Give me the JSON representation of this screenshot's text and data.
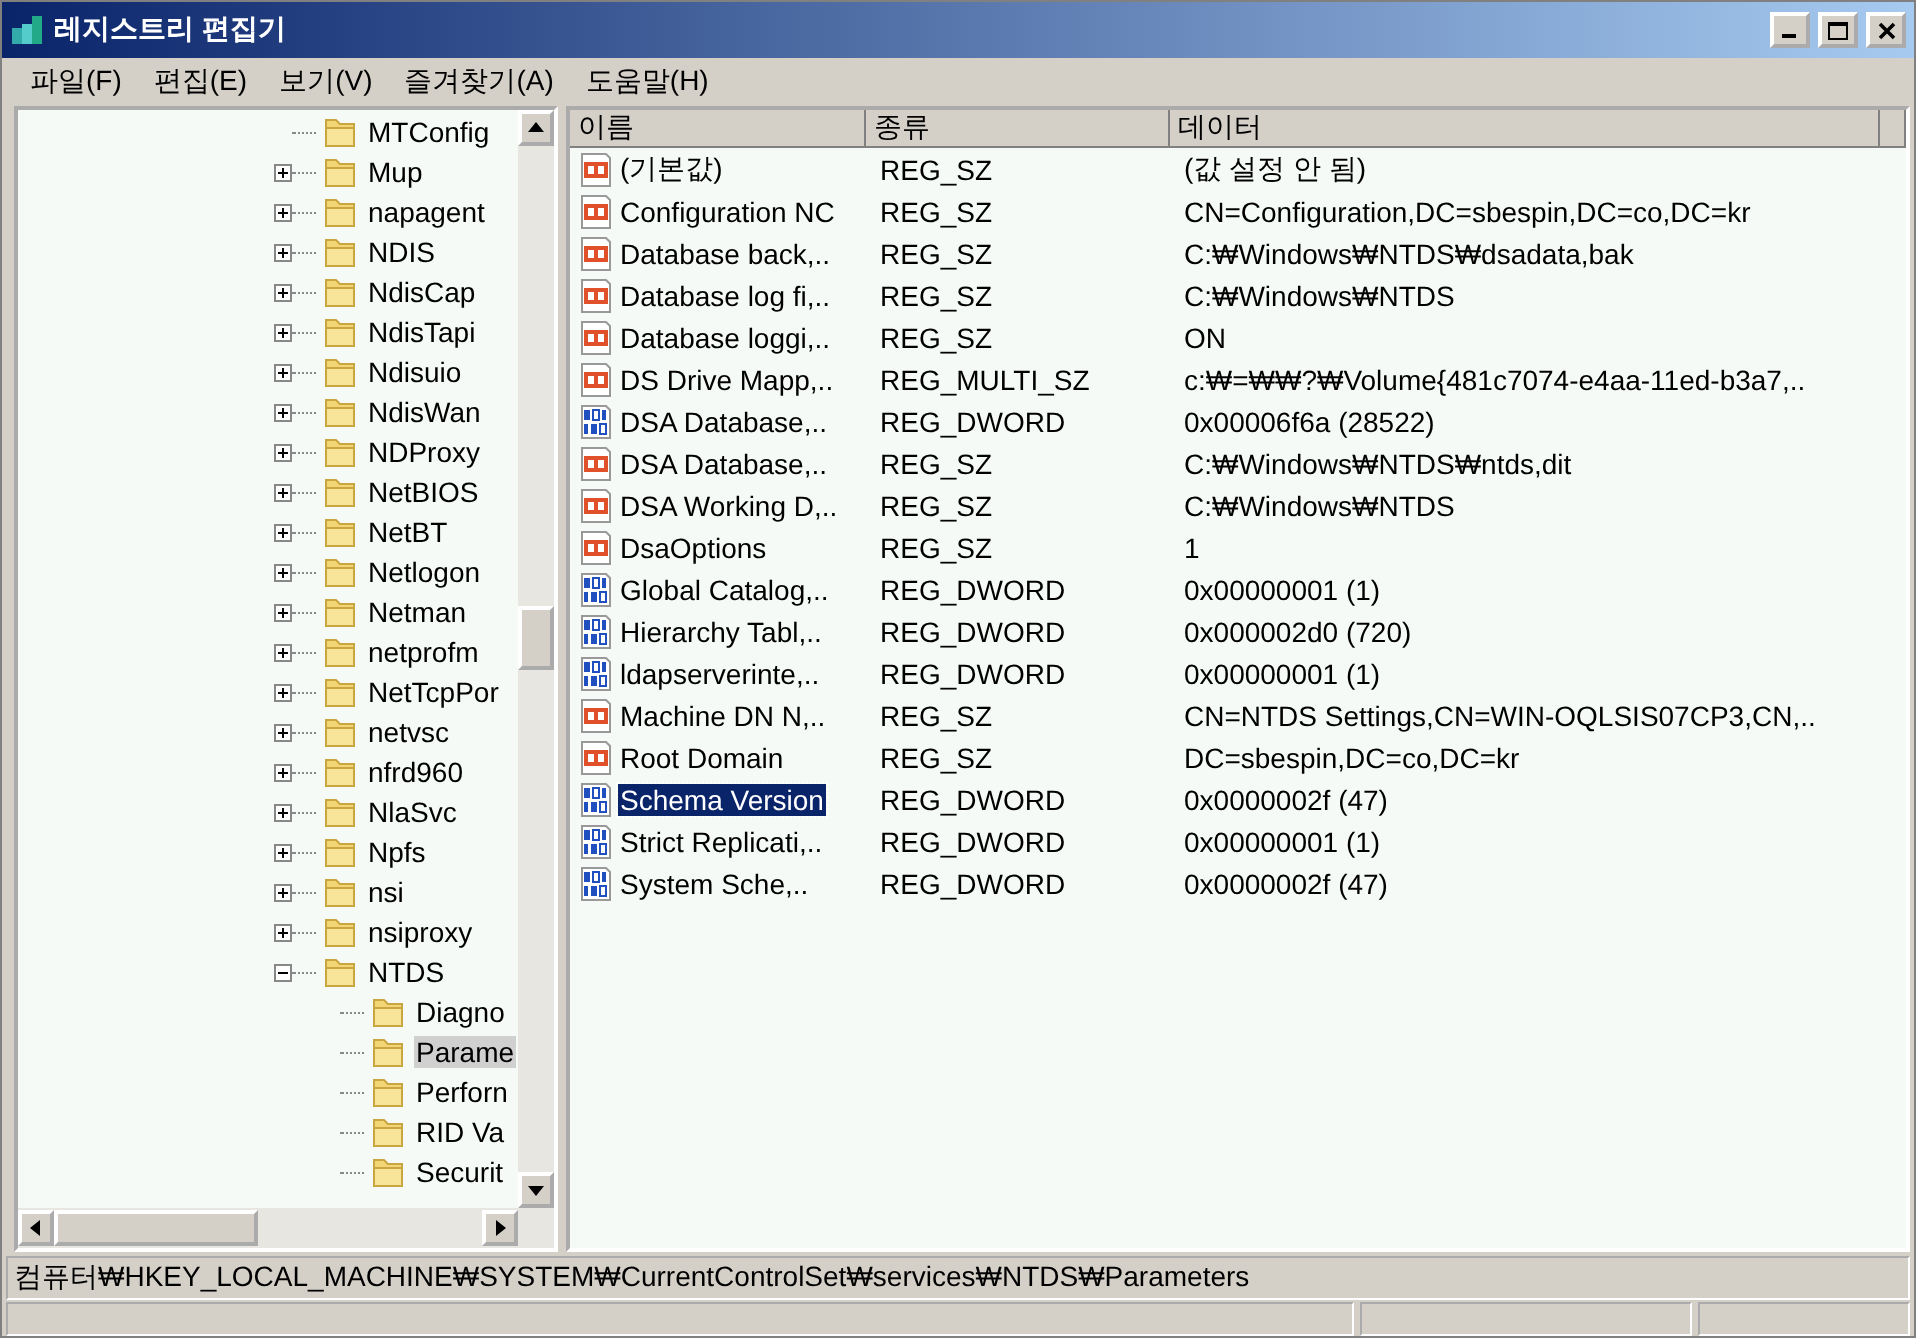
{
  "window": {
    "title": "레지스트리 편집기"
  },
  "menu": [
    "파일(F)",
    "편집(E)",
    "보기(V)",
    "즐겨찾기(A)",
    "도움말(H)"
  ],
  "tree": [
    {
      "label": "MTConfig",
      "selected": false
    },
    {
      "label": "Mup",
      "expanded": false,
      "selected": false
    },
    {
      "label": "napagent",
      "expanded": false,
      "selected": false
    },
    {
      "label": "NDIS",
      "expanded": false,
      "selected": false
    },
    {
      "label": "NdisCap",
      "expanded": false,
      "selected": false
    },
    {
      "label": "NdisTapi",
      "expanded": false,
      "selected": false
    },
    {
      "label": "Ndisuio",
      "expanded": false,
      "selected": false
    },
    {
      "label": "NdisWan",
      "expanded": false,
      "selected": false
    },
    {
      "label": "NDProxy",
      "expanded": false,
      "selected": false
    },
    {
      "label": "NetBIOS",
      "expanded": false,
      "selected": false
    },
    {
      "label": "NetBT",
      "expanded": false,
      "selected": false
    },
    {
      "label": "Netlogon",
      "expanded": false,
      "selected": false
    },
    {
      "label": "Netman",
      "expanded": false,
      "selected": false
    },
    {
      "label": "netprofm",
      "expanded": false,
      "selected": false
    },
    {
      "label": "NetTcpPor",
      "expanded": false,
      "selected": false
    },
    {
      "label": "netvsc",
      "expanded": false,
      "selected": false
    },
    {
      "label": "nfrd960",
      "expanded": false,
      "selected": false
    },
    {
      "label": "NlaSvc",
      "expanded": false,
      "selected": false
    },
    {
      "label": "Npfs",
      "expanded": false,
      "selected": false
    },
    {
      "label": "nsi",
      "expanded": false,
      "selected": false
    },
    {
      "label": "nsiproxy",
      "expanded": false,
      "selected": false
    },
    {
      "label": "NTDS",
      "expanded": true,
      "selected": false,
      "children": [
        {
          "label": "Diagno",
          "selected": false
        },
        {
          "label": "Parame",
          "selected": true
        },
        {
          "label": "Perforn",
          "selected": false
        },
        {
          "label": "RID Va",
          "selected": false
        },
        {
          "label": "Securit",
          "selected": false
        }
      ]
    }
  ],
  "table": {
    "columns": [
      "이름",
      "종류",
      "데이터"
    ],
    "rows": [
      {
        "kind": "string",
        "name": "(기본값)",
        "type": "REG_SZ",
        "data": "(값 설정 안 됨)",
        "selected": false
      },
      {
        "kind": "string",
        "name": "Configuration NC",
        "type": "REG_SZ",
        "data": "CN=Configuration,DC=sbespin,DC=co,DC=kr",
        "selected": false
      },
      {
        "kind": "string",
        "name": "Database back,..",
        "type": "REG_SZ",
        "data": "C:₩Windows₩NTDS₩dsadata,bak",
        "selected": false
      },
      {
        "kind": "string",
        "name": "Database log fi,..",
        "type": "REG_SZ",
        "data": "C:₩Windows₩NTDS",
        "selected": false
      },
      {
        "kind": "string",
        "name": "Database loggi,..",
        "type": "REG_SZ",
        "data": "ON",
        "selected": false
      },
      {
        "kind": "string",
        "name": "DS Drive Mapp,..",
        "type": "REG_MULTI_SZ",
        "data": "c:₩=₩₩?₩Volume{481c7074-e4aa-11ed-b3a7,..",
        "selected": false
      },
      {
        "kind": "dword",
        "name": "DSA Database,..",
        "type": "REG_DWORD",
        "data": "0x00006f6a (28522)",
        "selected": false
      },
      {
        "kind": "string",
        "name": "DSA Database,..",
        "type": "REG_SZ",
        "data": "C:₩Windows₩NTDS₩ntds,dit",
        "selected": false
      },
      {
        "kind": "string",
        "name": "DSA Working D,..",
        "type": "REG_SZ",
        "data": "C:₩Windows₩NTDS",
        "selected": false
      },
      {
        "kind": "string",
        "name": "DsaOptions",
        "type": "REG_SZ",
        "data": "1",
        "selected": false
      },
      {
        "kind": "dword",
        "name": "Global Catalog,..",
        "type": "REG_DWORD",
        "data": "0x00000001 (1)",
        "selected": false
      },
      {
        "kind": "dword",
        "name": "Hierarchy Tabl,..",
        "type": "REG_DWORD",
        "data": "0x000002d0 (720)",
        "selected": false
      },
      {
        "kind": "dword",
        "name": "ldapserverinte,..",
        "type": "REG_DWORD",
        "data": "0x00000001 (1)",
        "selected": false
      },
      {
        "kind": "string",
        "name": "Machine DN N,..",
        "type": "REG_SZ",
        "data": "CN=NTDS Settings,CN=WIN-OQLSIS07CP3,CN,..",
        "selected": false
      },
      {
        "kind": "string",
        "name": "Root Domain",
        "type": "REG_SZ",
        "data": "DC=sbespin,DC=co,DC=kr",
        "selected": false
      },
      {
        "kind": "dword",
        "name": "Schema Version",
        "type": "REG_DWORD",
        "data": "0x0000002f (47)",
        "selected": true
      },
      {
        "kind": "dword",
        "name": "Strict Replicati,..",
        "type": "REG_DWORD",
        "data": "0x00000001 (1)",
        "selected": false
      },
      {
        "kind": "dword",
        "name": "System Sche,..",
        "type": "REG_DWORD",
        "data": "0x0000002f (47)",
        "selected": false
      }
    ]
  },
  "address_bar": "컴퓨터₩HKEY_LOCAL_MACHINE₩SYSTEM₩CurrentControlSet₩services₩NTDS₩Parameters"
}
